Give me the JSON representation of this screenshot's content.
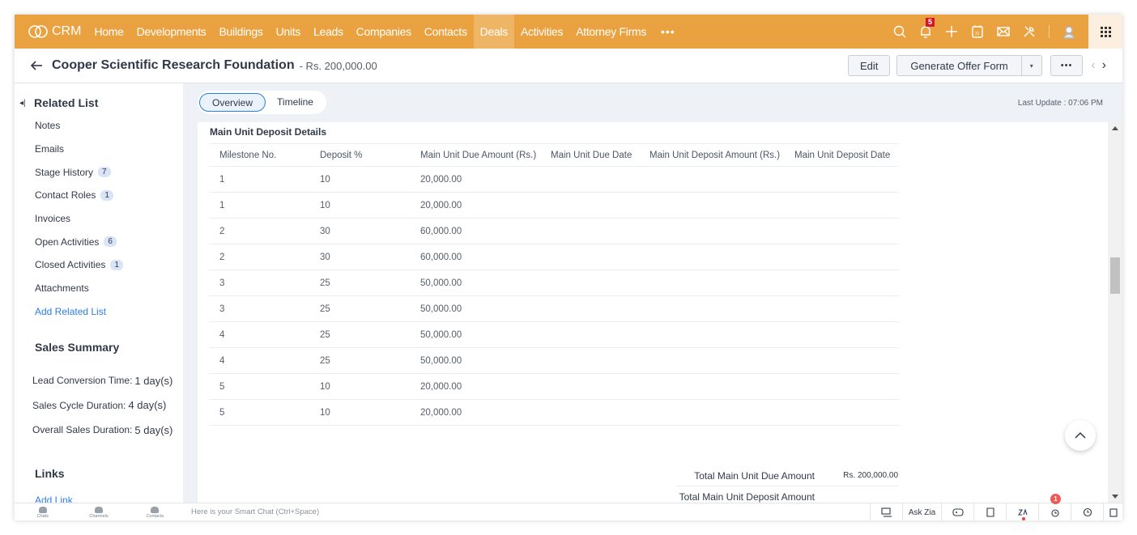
{
  "app": {
    "name": "CRM",
    "nav_items": [
      "Home",
      "Developments",
      "Buildings",
      "Units",
      "Leads",
      "Companies",
      "Contacts",
      "Deals",
      "Activities",
      "Attorney Firms"
    ],
    "active_nav": "Deals",
    "more_label": "•••",
    "notification_count": "5",
    "icons": [
      "search-icon",
      "bell-icon",
      "plus-icon",
      "calendar-icon",
      "mail-icon",
      "tools-icon",
      "avatar-icon",
      "apps-grid-icon"
    ],
    "accent_color": "#e9a23f"
  },
  "record": {
    "title": "Cooper Scientific Research Foundation",
    "amount": "- Rs. 200,000.00",
    "edit_label": "Edit",
    "generate_label": "Generate Offer Form",
    "caret_label": "▾",
    "more_label": "•••",
    "prev_label": "‹",
    "next_label": "›"
  },
  "tabs": [
    {
      "label": "Overview",
      "active": true
    },
    {
      "label": "Timeline",
      "active": false
    }
  ],
  "last_update": "Last Update : 07:06 PM",
  "sidebar": {
    "related_list_title": "Related List",
    "items": [
      {
        "label": "Notes",
        "count": null
      },
      {
        "label": "Emails",
        "count": null
      },
      {
        "label": "Stage History",
        "count": "7"
      },
      {
        "label": "Contact Roles",
        "count": "1"
      },
      {
        "label": "Invoices",
        "count": null
      },
      {
        "label": "Open Activities",
        "count": "6"
      },
      {
        "label": "Closed Activities",
        "count": "1"
      },
      {
        "label": "Attachments",
        "count": null
      }
    ],
    "add_related_list": "Add Related List",
    "sales_summary_title": "Sales Summary",
    "sales_summary": [
      {
        "label": "Lead Conversion Time:",
        "value": "1 day(s)"
      },
      {
        "label": "Sales Cycle Duration:",
        "value": "4 day(s)"
      },
      {
        "label": "Overall Sales Duration:",
        "value": "5 day(s)"
      }
    ],
    "links_title": "Links",
    "add_link": "Add Link"
  },
  "deposit_section": {
    "title": "Main Unit Deposit Details",
    "columns": [
      "Milestone No.",
      "Deposit %",
      "Main Unit Due Amount (Rs.)",
      "Main Unit Due Date",
      "Main Unit Deposit Amount (Rs.)",
      "Main Unit Deposit Date"
    ],
    "rows": [
      [
        "1",
        "10",
        "20,000.00",
        "",
        "",
        ""
      ],
      [
        "1",
        "10",
        "20,000.00",
        "",
        "",
        ""
      ],
      [
        "2",
        "30",
        "60,000.00",
        "",
        "",
        ""
      ],
      [
        "2",
        "30",
        "60,000.00",
        "",
        "",
        ""
      ],
      [
        "3",
        "25",
        "50,000.00",
        "",
        "",
        ""
      ],
      [
        "3",
        "25",
        "50,000.00",
        "",
        "",
        ""
      ],
      [
        "4",
        "25",
        "50,000.00",
        "",
        "",
        ""
      ],
      [
        "4",
        "25",
        "50,000.00",
        "",
        "",
        ""
      ],
      [
        "5",
        "10",
        "20,000.00",
        "",
        "",
        ""
      ],
      [
        "5",
        "10",
        "20,000.00",
        "",
        "",
        ""
      ]
    ],
    "totals": [
      {
        "label": "Total Main Unit Due Amount",
        "value": "Rs. 200,000.00"
      },
      {
        "label": "Total Main Unit Deposit Amount",
        "value": ""
      }
    ]
  },
  "bottom_bar": {
    "tabs": [
      "Chats",
      "Channels",
      "Contacts"
    ],
    "smart_chat_placeholder": "Here is your Smart Chat (Ctrl+Space)",
    "ask_zia": "Ask Zia",
    "alarm_badge": "1"
  }
}
